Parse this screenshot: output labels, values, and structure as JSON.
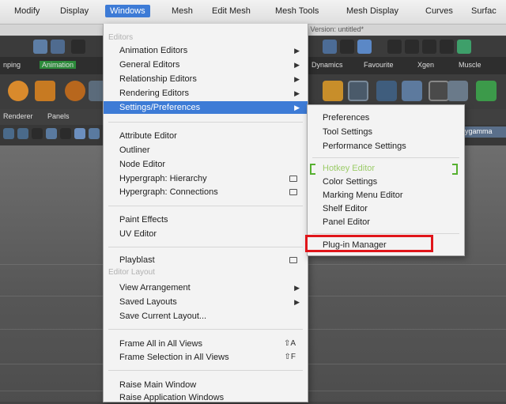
{
  "menubar": {
    "items": [
      {
        "label": "Modify"
      },
      {
        "label": "Display"
      },
      {
        "label": "Windows"
      },
      {
        "label": "Mesh"
      },
      {
        "label": "Edit Mesh"
      },
      {
        "label": "Mesh Tools"
      },
      {
        "label": "Mesh Display"
      },
      {
        "label": "Curves"
      },
      {
        "label": "Surfac"
      }
    ]
  },
  "title_fragment": "st Version: untitled*",
  "shelf_tabs": [
    "nping",
    "Animation",
    "Dynamics",
    "Favourite",
    "Xgen",
    "Muscle"
  ],
  "panel_bar": {
    "left_label": "Renderer",
    "menu_label": "Panels",
    "right_label": "ygamma"
  },
  "windows_menu": {
    "sections": [
      {
        "header": "Editors"
      },
      {
        "label": "Animation Editors",
        "submenu": true
      },
      {
        "label": "General Editors",
        "submenu": true
      },
      {
        "label": "Relationship Editors",
        "submenu": true
      },
      {
        "label": "Rendering Editors",
        "submenu": true
      },
      {
        "label": "Settings/Preferences",
        "submenu": true,
        "highlighted": true
      },
      {
        "label": "Attribute Editor"
      },
      {
        "label": "Outliner"
      },
      {
        "label": "Node Editor"
      },
      {
        "label": "Hypergraph: Hierarchy",
        "option_box": true
      },
      {
        "label": "Hypergraph: Connections",
        "option_box": true
      },
      {
        "label": "Paint Effects"
      },
      {
        "label": "UV Editor"
      },
      {
        "label": "Playblast",
        "option_box": true
      },
      {
        "header": "Editor Layout"
      },
      {
        "label": "View Arrangement",
        "submenu": true
      },
      {
        "label": "Saved Layouts",
        "submenu": true
      },
      {
        "label": "Save Current Layout..."
      },
      {
        "label": "Frame All in All Views",
        "shortcut": "⇧A"
      },
      {
        "label": "Frame Selection in All Views",
        "shortcut": "⇧F"
      },
      {
        "label": "Raise Main Window"
      },
      {
        "label": "Raise Application Windows"
      }
    ]
  },
  "settings_submenu": {
    "items": [
      {
        "label": "Preferences"
      },
      {
        "label": "Tool Settings"
      },
      {
        "label": "Performance Settings"
      },
      {
        "label": "Hotkey Editor",
        "disabled": true
      },
      {
        "label": "Color Settings"
      },
      {
        "label": "Marking Menu Editor"
      },
      {
        "label": "Shelf Editor"
      },
      {
        "label": "Panel Editor"
      },
      {
        "label": "Plug-in Manager",
        "annotated": true
      }
    ]
  },
  "colors": {
    "highlight": "#3d7bd6",
    "annotation_box": "#e0151a",
    "disabled_text": "#9ccc6a"
  }
}
